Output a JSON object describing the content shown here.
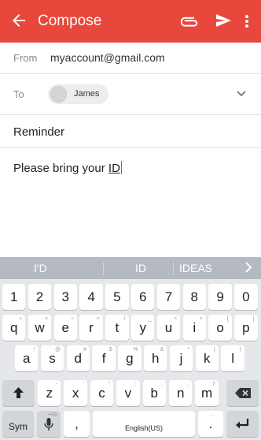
{
  "appbar": {
    "title": "Compose",
    "back_icon": "arrow-left-icon",
    "attach_icon": "paperclip-icon",
    "send_icon": "send-icon",
    "more_icon": "more-vert-icon",
    "color": "#e8473c"
  },
  "from": {
    "label": "From",
    "value": "myaccount@gmail.com"
  },
  "to": {
    "label": "To",
    "recipient": "James"
  },
  "subject": "Reminder",
  "body": {
    "text": "Please bring your ",
    "underlined": "ID"
  },
  "keyboard": {
    "suggestions": [
      "I'D",
      "ID",
      "IDEAS"
    ],
    "row1": [
      {
        "k": "1"
      },
      {
        "k": "2"
      },
      {
        "k": "3"
      },
      {
        "k": "4"
      },
      {
        "k": "5"
      },
      {
        "k": "6"
      },
      {
        "k": "7"
      },
      {
        "k": "8"
      },
      {
        "k": "9"
      },
      {
        "k": "0"
      }
    ],
    "row2": [
      {
        "k": "q",
        "s": "+"
      },
      {
        "k": "w",
        "s": "×"
      },
      {
        "k": "e",
        "s": "÷"
      },
      {
        "k": "r",
        "s": "="
      },
      {
        "k": "t",
        "s": "/"
      },
      {
        "k": "y",
        "s": "_"
      },
      {
        "k": "u",
        "s": "<"
      },
      {
        "k": "i",
        "s": ">"
      },
      {
        "k": "o",
        "s": "["
      },
      {
        "k": "p",
        "s": "]"
      }
    ],
    "row3": [
      {
        "k": "a",
        "s": "!"
      },
      {
        "k": "s",
        "s": "@"
      },
      {
        "k": "d",
        "s": "#"
      },
      {
        "k": "f",
        "s": "$"
      },
      {
        "k": "g",
        "s": "%"
      },
      {
        "k": "h",
        "s": "&"
      },
      {
        "k": "j",
        "s": "*"
      },
      {
        "k": "k",
        "s": "("
      },
      {
        "k": "l",
        "s": ")"
      }
    ],
    "row4": [
      {
        "k": "z",
        "s": "-"
      },
      {
        "k": "x",
        "s": "'"
      },
      {
        "k": "c",
        "s": "\""
      },
      {
        "k": "v",
        "s": ":"
      },
      {
        "k": "b",
        "s": ";"
      },
      {
        "k": "n",
        "s": ","
      },
      {
        "k": "m",
        "s": "?"
      }
    ],
    "sym_label": "Sym",
    "comma_label": ",",
    "comma_sec": "",
    "space_label": "English(US)",
    "period_label": ".",
    "period_sec": "…",
    "mic_sec": "••⚙"
  }
}
